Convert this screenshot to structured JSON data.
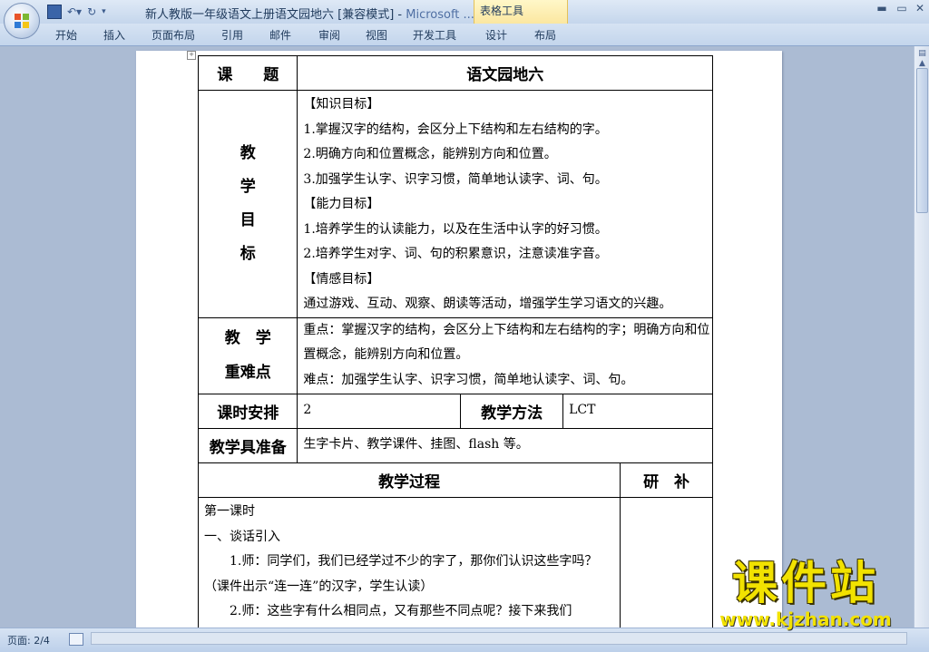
{
  "window": {
    "title": "新人教版一年级语文上册语文园地六 [兼容模式] - Microsoft ...",
    "title_doc": "新人教版一年级语文上册语文园地六 [兼容模式] - ",
    "title_app": "Microsoft ...",
    "context_group": "表格工具"
  },
  "ribbon": {
    "tabs": [
      "开始",
      "插入",
      "页面布局",
      "引用",
      "邮件",
      "审阅",
      "视图",
      "开发工具",
      "设计",
      "布局"
    ]
  },
  "status": {
    "page": "页面: 2/4"
  },
  "lesson": {
    "topic_label": "课　　题",
    "topic_value": "语文园地六",
    "goals_label": [
      "教",
      "学",
      "目",
      "标"
    ],
    "goals_lines": [
      "【知识目标】",
      "1.掌握汉字的结构，会区分上下结构和左右结构的字。",
      "2.明确方向和位置概念，能辨别方向和位置。",
      "3.加强学生认字、识字习惯，简单地认读字、词、句。",
      "【能力目标】",
      "1.培养学生的认读能力，以及在生活中认字的好习惯。",
      "2.培养学生对字、词、句的积累意识，注意读准字音。",
      "【情感目标】",
      "通过游戏、互动、观察、朗读等活动，增强学生学习语文的兴趣。"
    ],
    "key_label_1": "教　学",
    "key_label_2": "重难点",
    "key_text_1": "重点：掌握汉字的结构，会区分上下结构和左右结构的字；明确方向和位置概念，能辨别方向和位置。",
    "key_text_2": "难点：加强学生认字、识字习惯，简单地认读字、词、句。",
    "hours_label": "课时安排",
    "hours_value": "2",
    "method_label": "教学方法",
    "method_value": "LCT",
    "prep_label": "教学具准备",
    "prep_value": "生字卡片、教学课件、挂图、flash 等。",
    "process_header": "教学过程",
    "research_header": "研　补",
    "process_lines": [
      "第一课时",
      "一、谈话引入",
      "1.师：同学们，我们已经学过不少的字了，那你们认识这些字吗？（课件出示“连一连”的汉字，学生认读）",
      "2.师：这些字有什么相同点，又有那些不同点呢？接下来我们"
    ]
  },
  "watermark": {
    "text": "课件站",
    "url": "www.kjzhan.com"
  },
  "colors": {
    "workspace": "#abbbd3",
    "watermark": "#f2e200"
  }
}
